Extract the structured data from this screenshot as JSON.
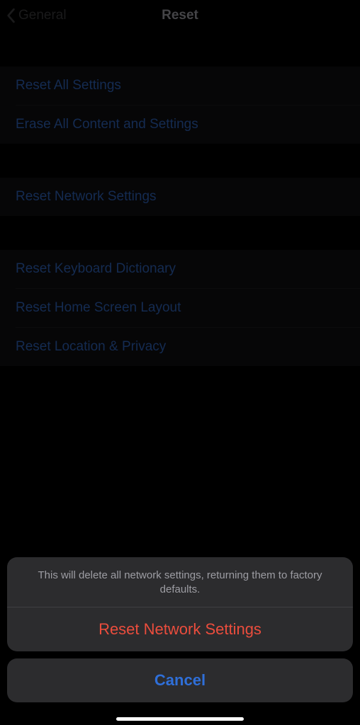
{
  "nav": {
    "back_label": "General",
    "title": "Reset"
  },
  "groups": [
    {
      "items": [
        {
          "label": "Reset All Settings"
        },
        {
          "label": "Erase All Content and Settings"
        }
      ]
    },
    {
      "items": [
        {
          "label": "Reset Network Settings"
        }
      ]
    },
    {
      "items": [
        {
          "label": "Reset Keyboard Dictionary"
        },
        {
          "label": "Reset Home Screen Layout"
        },
        {
          "label": "Reset Location & Privacy"
        }
      ]
    }
  ],
  "action_sheet": {
    "message": "This will delete all network settings, returning them to factory defaults.",
    "destructive_label": "Reset Network Settings",
    "cancel_label": "Cancel"
  }
}
